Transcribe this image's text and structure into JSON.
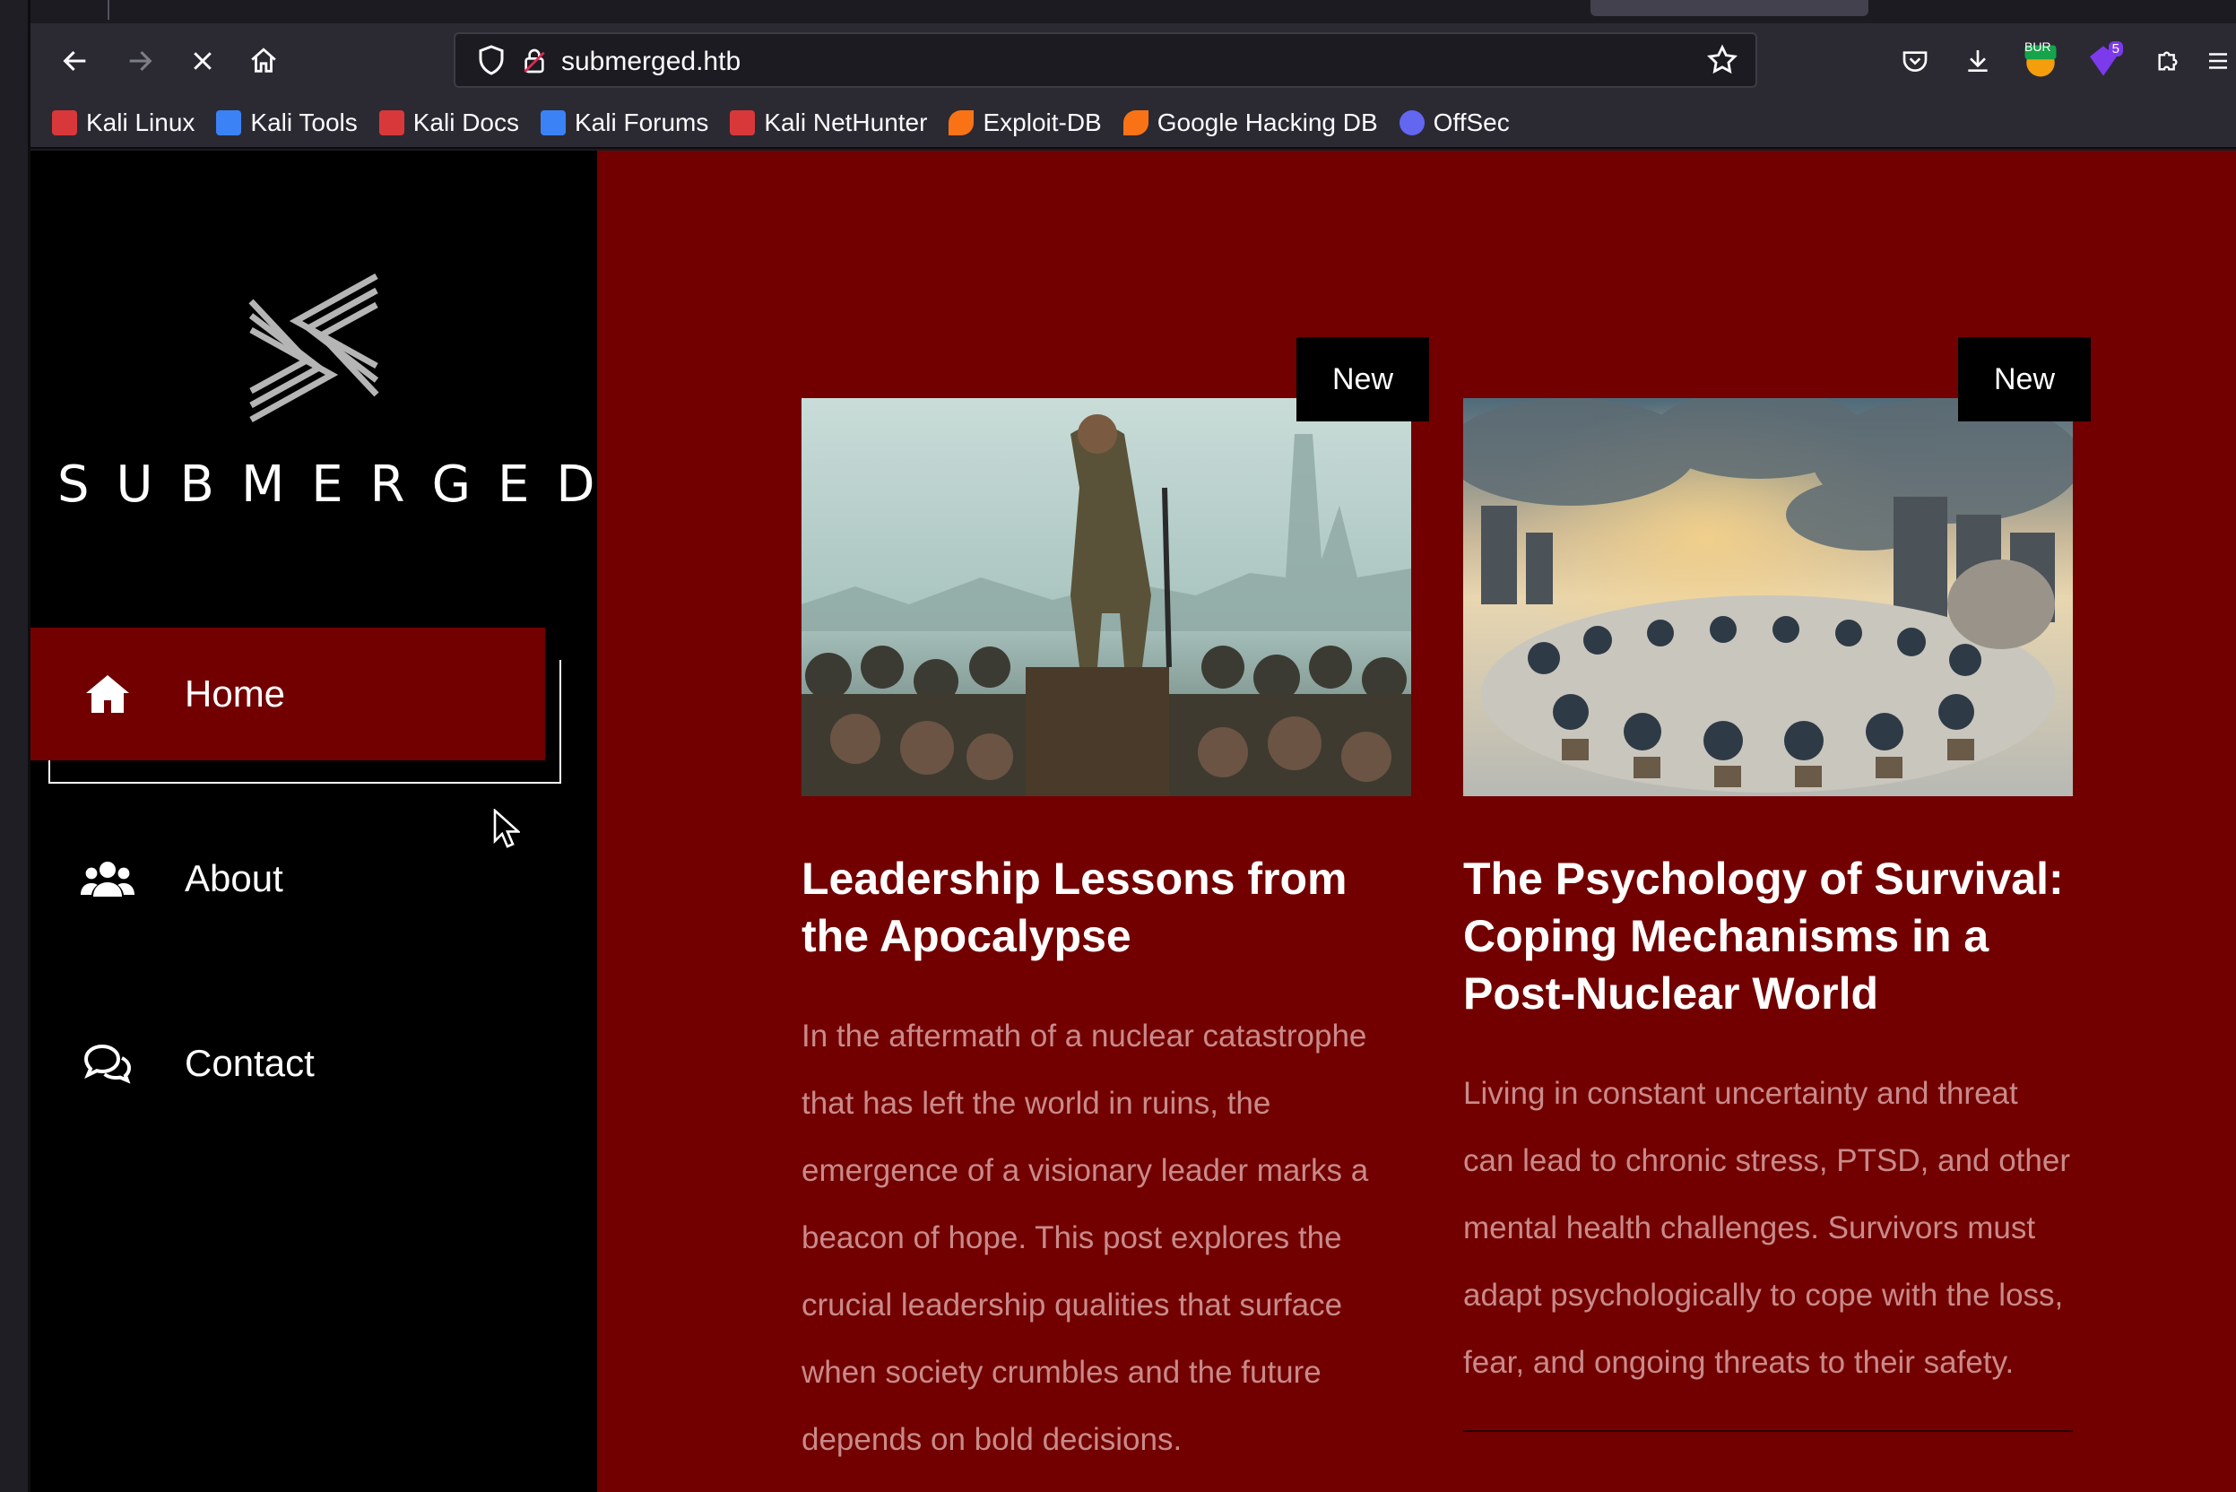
{
  "browser": {
    "url": "submerged.htb",
    "extension_badge": "5",
    "burp_label": "BUR"
  },
  "bookmarks": [
    {
      "label": "Kali Linux",
      "icon": "kali-dragon-icon",
      "color": "#d9383a"
    },
    {
      "label": "Kali Tools",
      "icon": "kali-tools-icon",
      "color": "#3b82f6"
    },
    {
      "label": "Kali Docs",
      "icon": "kali-docs-icon",
      "color": "#d9383a"
    },
    {
      "label": "Kali Forums",
      "icon": "kali-forums-icon",
      "color": "#3b82f6"
    },
    {
      "label": "Kali NetHunter",
      "icon": "kali-nethunter-icon",
      "color": "#d9383a"
    },
    {
      "label": "Exploit-DB",
      "icon": "exploit-db-icon",
      "color": "#f97316"
    },
    {
      "label": "Google Hacking DB",
      "icon": "ghdb-icon",
      "color": "#f97316"
    },
    {
      "label": "OffSec",
      "icon": "offsec-icon",
      "color": "#6366f1"
    }
  ],
  "sidebar": {
    "logo_text": "SUBMERGED",
    "nav": [
      {
        "label": "Home",
        "icon": "home-icon",
        "active": true
      },
      {
        "label": "About",
        "icon": "users-icon",
        "active": false
      },
      {
        "label": "Contact",
        "icon": "chat-icon",
        "active": false
      }
    ]
  },
  "posts": [
    {
      "badge": "New",
      "title": "Leadership Lessons from the Apocalypse",
      "excerpt": "In the aftermath of a nuclear catastrophe that has left the world in ruins, the emergence of a visionary leader marks a beacon of hope. This post explores the crucial leadership qualities that surface when society crumbles and the future depends on bold decisions.",
      "image": "leader-crowd-illustration"
    },
    {
      "badge": "New",
      "title": "The Psychology of Survival: Coping Mechanisms in a Post-Nuclear World",
      "excerpt": "Living in constant uncertainty and threat can lead to chronic stress, PTSD, and other mental health challenges. Survivors must adapt psychologically to cope with the loss, fear, and ongoing threats to their safety.",
      "image": "survivors-circle-illustration"
    }
  ],
  "colors": {
    "page_bg": "#720000",
    "sidebar_bg": "#000000",
    "excerpt_text": "#c98a8a"
  }
}
